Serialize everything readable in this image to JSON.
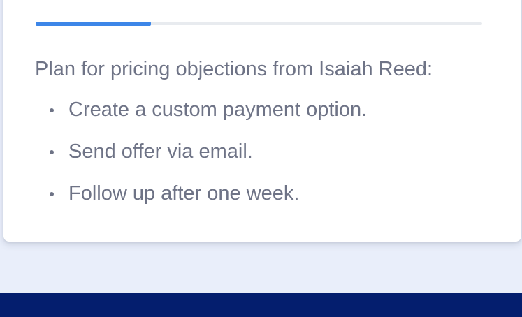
{
  "card": {
    "progress_fraction": 0.258,
    "plan_heading": "Plan for pricing objections from Isaiah Reed:",
    "plan_items": [
      "Create a custom payment option.",
      "Send offer via email.",
      "Follow up after one week."
    ]
  },
  "colors": {
    "page_background": "#e9eefa",
    "card_background": "#ffffff",
    "progress_fill": "#3d86e8",
    "progress_track": "#e8ebef",
    "text": "#6e7386",
    "footer_bar": "#041e6e"
  }
}
